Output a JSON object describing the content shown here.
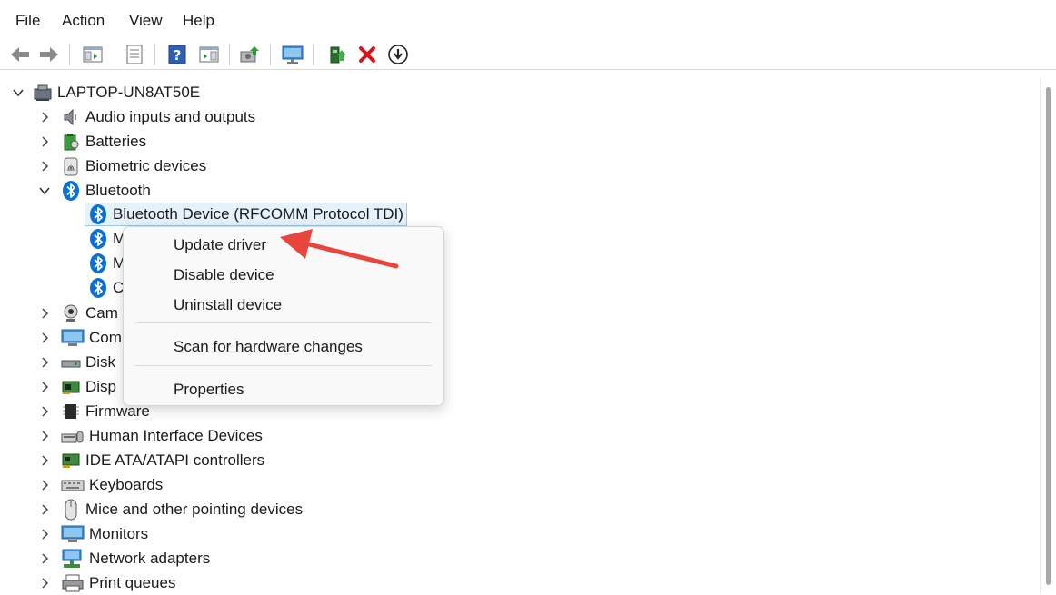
{
  "menubar": {
    "items": [
      "File",
      "Action",
      "View",
      "Help"
    ]
  },
  "toolbar": {
    "buttons": [
      "back-icon",
      "forward-icon",
      "show-hide-console-tree-icon",
      "properties-icon",
      "help-icon",
      "action-pane-icon",
      "scan-hardware-icon",
      "monitor-icon",
      "update-driver-icon",
      "uninstall-icon",
      "download-icon"
    ]
  },
  "tree": {
    "root": "LAPTOP-UN8AT50E",
    "categories": {
      "audio": "Audio inputs and outputs",
      "batteries": "Batteries",
      "biometric": "Biometric devices",
      "bluetooth": "Bluetooth",
      "bt_selected": "Bluetooth Device (RFCOMM Protocol TDI)",
      "bt_m1": "M",
      "bt_m2": "M",
      "bt_c": "C",
      "cameras": "Cam",
      "computer": "Com",
      "disk": "Disk",
      "display": "Disp",
      "firmware": "Firmware",
      "hid": "Human Interface Devices",
      "ide": "IDE ATA/ATAPI controllers",
      "keyboards": "Keyboards",
      "mice": "Mice and other pointing devices",
      "monitors": "Monitors",
      "network": "Network adapters",
      "print": "Print queues"
    }
  },
  "context_menu": {
    "update": "Update driver",
    "disable": "Disable device",
    "uninstall": "Uninstall device",
    "scan": "Scan for hardware changes",
    "properties": "Properties"
  },
  "colors": {
    "bluetooth": "#0a6fd6",
    "annotation_arrow": "#e8453c",
    "selection_bg": "#e5f1fb",
    "uninstall_red": "#d9121b"
  }
}
